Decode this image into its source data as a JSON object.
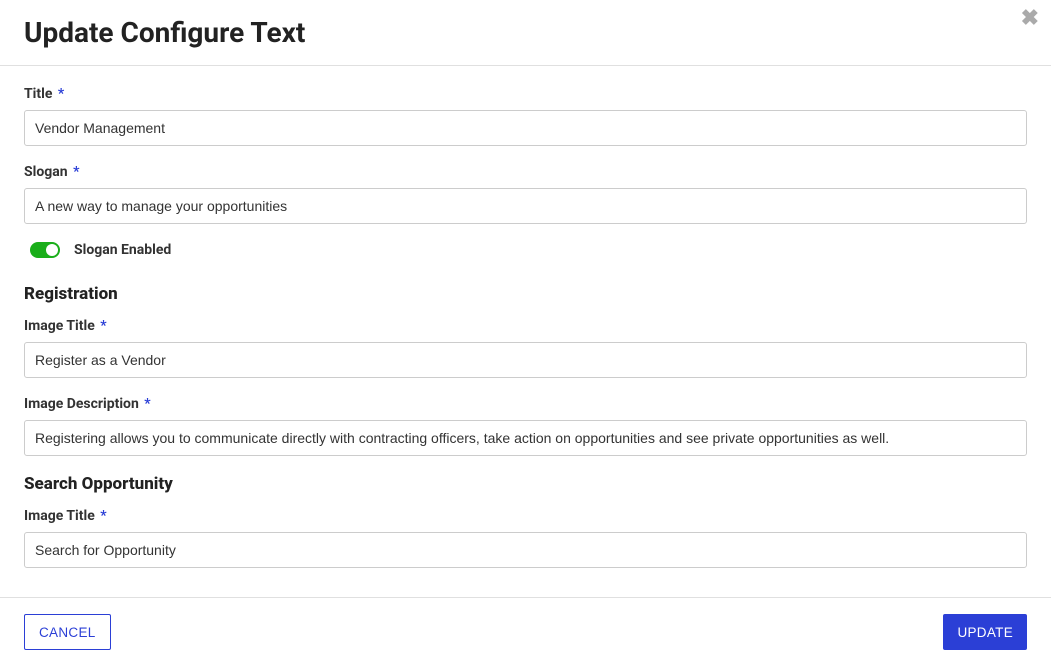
{
  "modal": {
    "title": "Update Configure Text",
    "close_label": "✖"
  },
  "form": {
    "title": {
      "label": "Title",
      "required_mark": "*",
      "value": "Vendor Management"
    },
    "slogan": {
      "label": "Slogan",
      "required_mark": "*",
      "value": "A new way to manage your opportunities"
    },
    "slogan_enabled": {
      "label": "Slogan Enabled",
      "value": true
    },
    "registration": {
      "heading": "Registration",
      "image_title": {
        "label": "Image Title",
        "required_mark": "*",
        "value": "Register as a Vendor"
      },
      "image_description": {
        "label": "Image Description",
        "required_mark": "*",
        "value": "Registering allows you to communicate directly with contracting officers, take action on opportunities and see private opportunities as well."
      }
    },
    "search_opportunity": {
      "heading": "Search Opportunity",
      "image_title": {
        "label": "Image Title",
        "required_mark": "*",
        "value": "Search for Opportunity"
      }
    }
  },
  "footer": {
    "cancel_label": "CANCEL",
    "update_label": "UPDATE"
  }
}
